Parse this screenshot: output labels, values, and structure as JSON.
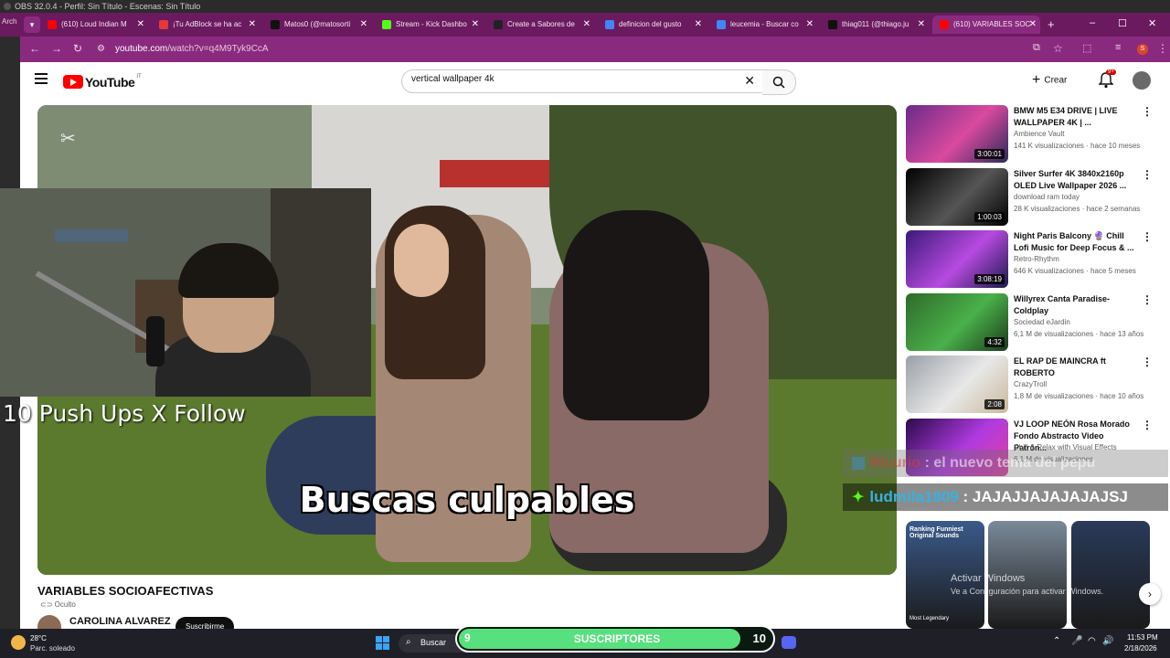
{
  "obs": {
    "title": "OBS 32.0.4 - Perfil: Sin Título - Escenas: Sin Título"
  },
  "browser": {
    "side_label": "Arch",
    "tabs": [
      {
        "title": "(610) Loud Indian M",
        "icon_color": "#ff0000",
        "icon": "youtube-icon"
      },
      {
        "title": "¡Tu AdBlock se ha ac",
        "icon_color": "#e53935",
        "icon": "adblock-icon"
      },
      {
        "title": "Matos0 (@matosorti",
        "icon_color": "#111111",
        "icon": "tiktok-icon"
      },
      {
        "title": "Stream - Kick Dashbo",
        "icon_color": "#53fc18",
        "icon": "kick-icon"
      },
      {
        "title": "Create a Sabores de ",
        "icon_color": "#222222",
        "icon": "page-icon"
      },
      {
        "title": "definicion del gusto",
        "icon_color": "#4285f4",
        "icon": "google-icon"
      },
      {
        "title": "leucemia - Buscar co",
        "icon_color": "#4285f4",
        "icon": "google-icon"
      },
      {
        "title": "thiag011 (@thiago.ju",
        "icon_color": "#111111",
        "icon": "tiktok-icon"
      },
      {
        "title": "(610) VARIABLES SOC",
        "icon_color": "#ff0000",
        "icon": "youtube-icon",
        "active": true
      }
    ],
    "new_tab": "+",
    "url_host": "youtube.com",
    "url_path": "/watch?v=q4M9Tyk9CcA"
  },
  "youtube": {
    "logo_text": "YouTube",
    "logo_country": "IT",
    "search_value": "vertical wallpaper 4k",
    "create_label": "Crear",
    "notif_badge": "9+",
    "video": {
      "subtitle": "Buscas culpables",
      "title": "VARIABLES SOCIOAFECTIVAS",
      "visibility": "Oculto",
      "channel": "CAROLINA ALVAREZ",
      "subscribe": "Suscribirme"
    },
    "recs": [
      {
        "title": "BMW M5 E34 DRIVE | LIVE WALLPAPER 4K | ...",
        "channel": "Ambience Vault",
        "meta": "141 K visualizaciones · hace 10 meses",
        "duration": "3:00:01",
        "colors": [
          "#6a2a8a",
          "#d94a9e",
          "#2a2a5a"
        ]
      },
      {
        "title": "Silver Surfer 4K 3840x2160p OLED Live Wallpaper 2026 ...",
        "channel": "download ram today",
        "meta": "28 K visualizaciones · hace 2 semanas",
        "duration": "1:00:03",
        "colors": [
          "#000000",
          "#555555",
          "#000000"
        ]
      },
      {
        "title": "Night Paris Balcony 🔮 Chill Lofi Music for Deep Focus & ...",
        "channel": "Retro-Rhythm",
        "meta": "646 K visualizaciones · hace 5 meses",
        "duration": "3:08:19",
        "colors": [
          "#3a1a7a",
          "#b84ae0",
          "#1a1a4a"
        ]
      },
      {
        "title": "Willyrex Canta Paradise- Coldplay",
        "channel": "Sociedad eJardin",
        "meta": "6,1 M de visualizaciones · hace 13 años",
        "duration": "4:32",
        "colors": [
          "#2f6a2a",
          "#4ab04a",
          "#1a3a1a"
        ]
      },
      {
        "title": "EL RAP DE MAINCRA ft ROBERTO",
        "channel": "CrazyTroll",
        "meta": "1,8 M de visualizaciones · hace 10 años",
        "duration": "2:08",
        "colors": [
          "#9aa0a8",
          "#e8e8e8",
          "#c8b89a"
        ]
      },
      {
        "title": "VJ LOOP NEÓN Rosa Morado Fondo Abstracto Video Patrón...",
        "channel": "Chill & Relax with Visual Effects",
        "meta": "6,1 M de visualizaciones",
        "duration": "",
        "colors": [
          "#2a0a4a",
          "#b03ae0",
          "#e040a0"
        ]
      }
    ],
    "shorts": [
      {
        "text": "Ranking Funniest Original Sounds",
        "bottom": "Most Legendary",
        "color": "#3a5a8a"
      },
      {
        "text": "",
        "bottom": "",
        "color": "#7a8a9a"
      },
      {
        "text": "",
        "bottom": "",
        "color": "#2a3a5a"
      }
    ]
  },
  "overlay": {
    "pushups": "10 Push Ups X Follow",
    "chat": [
      {
        "user": "Ricurio",
        "message": "el nuevo tema del pepu"
      },
      {
        "user": "ludmila1809",
        "message": "JAJAJJAJAJAJAJSJ"
      }
    ],
    "activate_title": "Activar Windows",
    "activate_sub": "Ve a Configuración para activar Windows."
  },
  "taskbar": {
    "temp": "28°C",
    "weather": "Parc. soleado",
    "search": "Buscar",
    "sub_current": "9",
    "sub_label": "SUSCRIPTORES",
    "sub_goal": "10",
    "sub_progress": 0.9,
    "time": "11:53 PM",
    "date": "2/18/2026"
  }
}
